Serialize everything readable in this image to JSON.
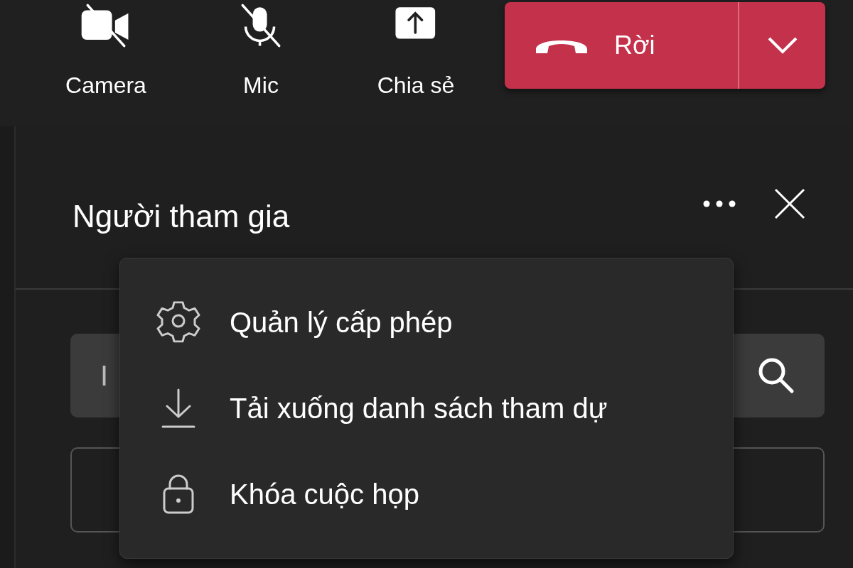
{
  "toolbar": {
    "buttons": [
      {
        "kind": "camera",
        "label": "Camera",
        "off": true
      },
      {
        "kind": "mic",
        "label": "Mic",
        "off": true
      },
      {
        "kind": "share",
        "label": "Chia sẻ",
        "off": false
      }
    ],
    "leave": {
      "label": "Rời"
    }
  },
  "panel": {
    "title": "Người tham gia",
    "search": {
      "placeholder": "I"
    }
  },
  "menu": {
    "items": [
      {
        "kind": "settings",
        "label": "Quản lý cấp phép"
      },
      {
        "kind": "download",
        "label": "Tải xuống danh sách tham dự"
      },
      {
        "kind": "lock",
        "label": "Khóa cuộc họp"
      }
    ]
  }
}
